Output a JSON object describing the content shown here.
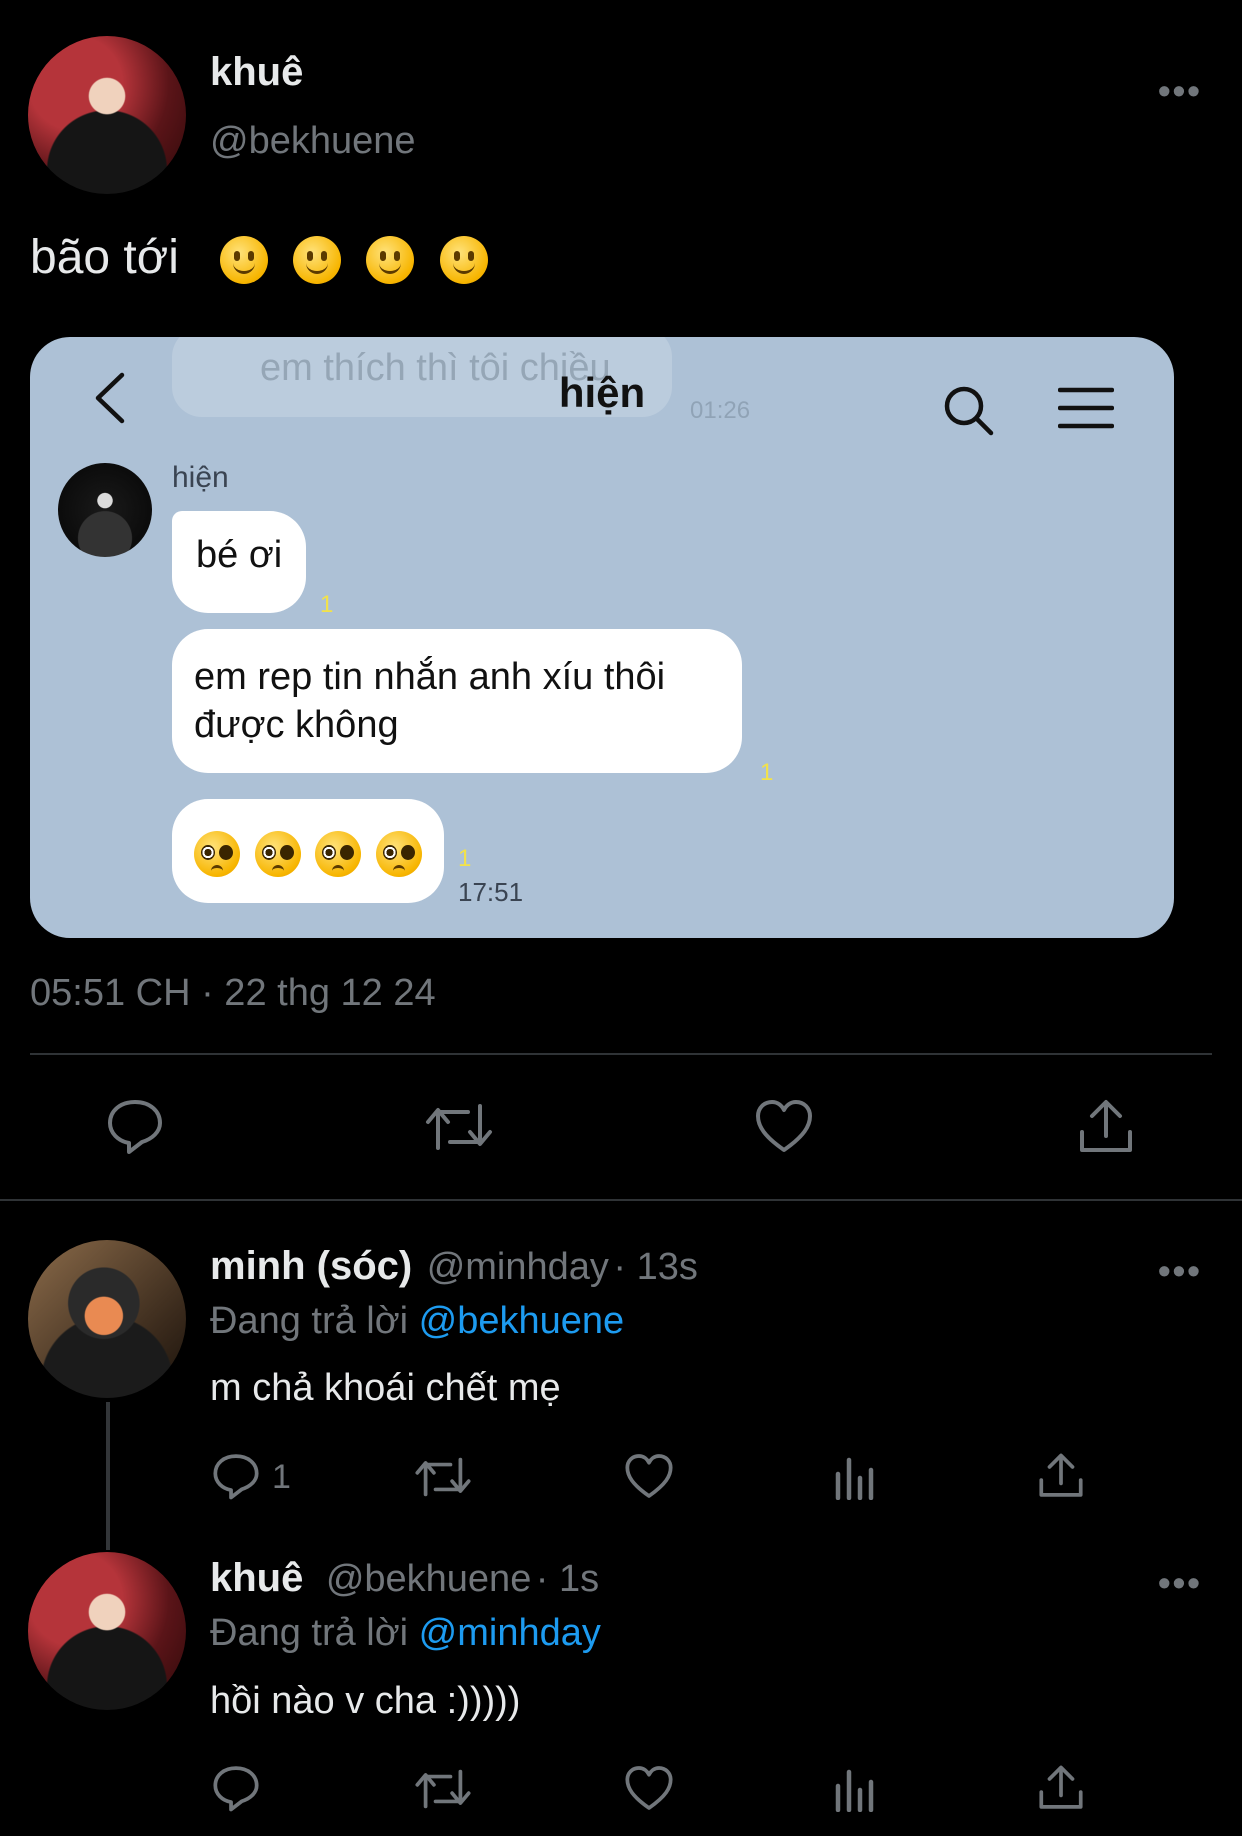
{
  "main_tweet": {
    "author_name": "khuê",
    "author_handle": "@bekhuene",
    "more_label": "•••",
    "text": "bão tới",
    "emoji_count_icons": [
      "slightly-smiling-face-icon",
      "slightly-smiling-face-icon",
      "slightly-smiling-face-icon",
      "slightly-smiling-face-icon"
    ],
    "timestamp": "05:51 CH · 22 thg 12 24"
  },
  "chat_screenshot": {
    "title": "hiện",
    "faded_message": "em thích thì tôi chiều",
    "faded_time": "01:26",
    "sender_name": "hiện",
    "messages": [
      {
        "text": "bé ơi",
        "read": "1"
      },
      {
        "text": "em rep tin nhắn anh xíu thôi được không",
        "read": "1"
      },
      {
        "text": "",
        "read": "1",
        "time": "17:51"
      }
    ],
    "bg_color": "#adc1d6"
  },
  "replies": [
    {
      "author_name": "minh (sóc)",
      "author_handle": "@minhday",
      "time": "· 13s",
      "replying_label": "Đang trả lời",
      "replying_to": "@bekhuene",
      "text": "m chả khoái chết mẹ",
      "reply_count": "1",
      "more_label": "•••"
    },
    {
      "author_name": "khuê",
      "author_handle": "@bekhuene",
      "time": "· 1s",
      "replying_label": "Đang trả lời",
      "replying_to": "@minhday",
      "text": "hồi nào v cha :)))))",
      "reply_count": "",
      "more_label": "•••"
    }
  ],
  "colors": {
    "background": "#000000",
    "accent": "#1d9bf0",
    "muted": "#71767b",
    "text": "#e7e9ea"
  }
}
